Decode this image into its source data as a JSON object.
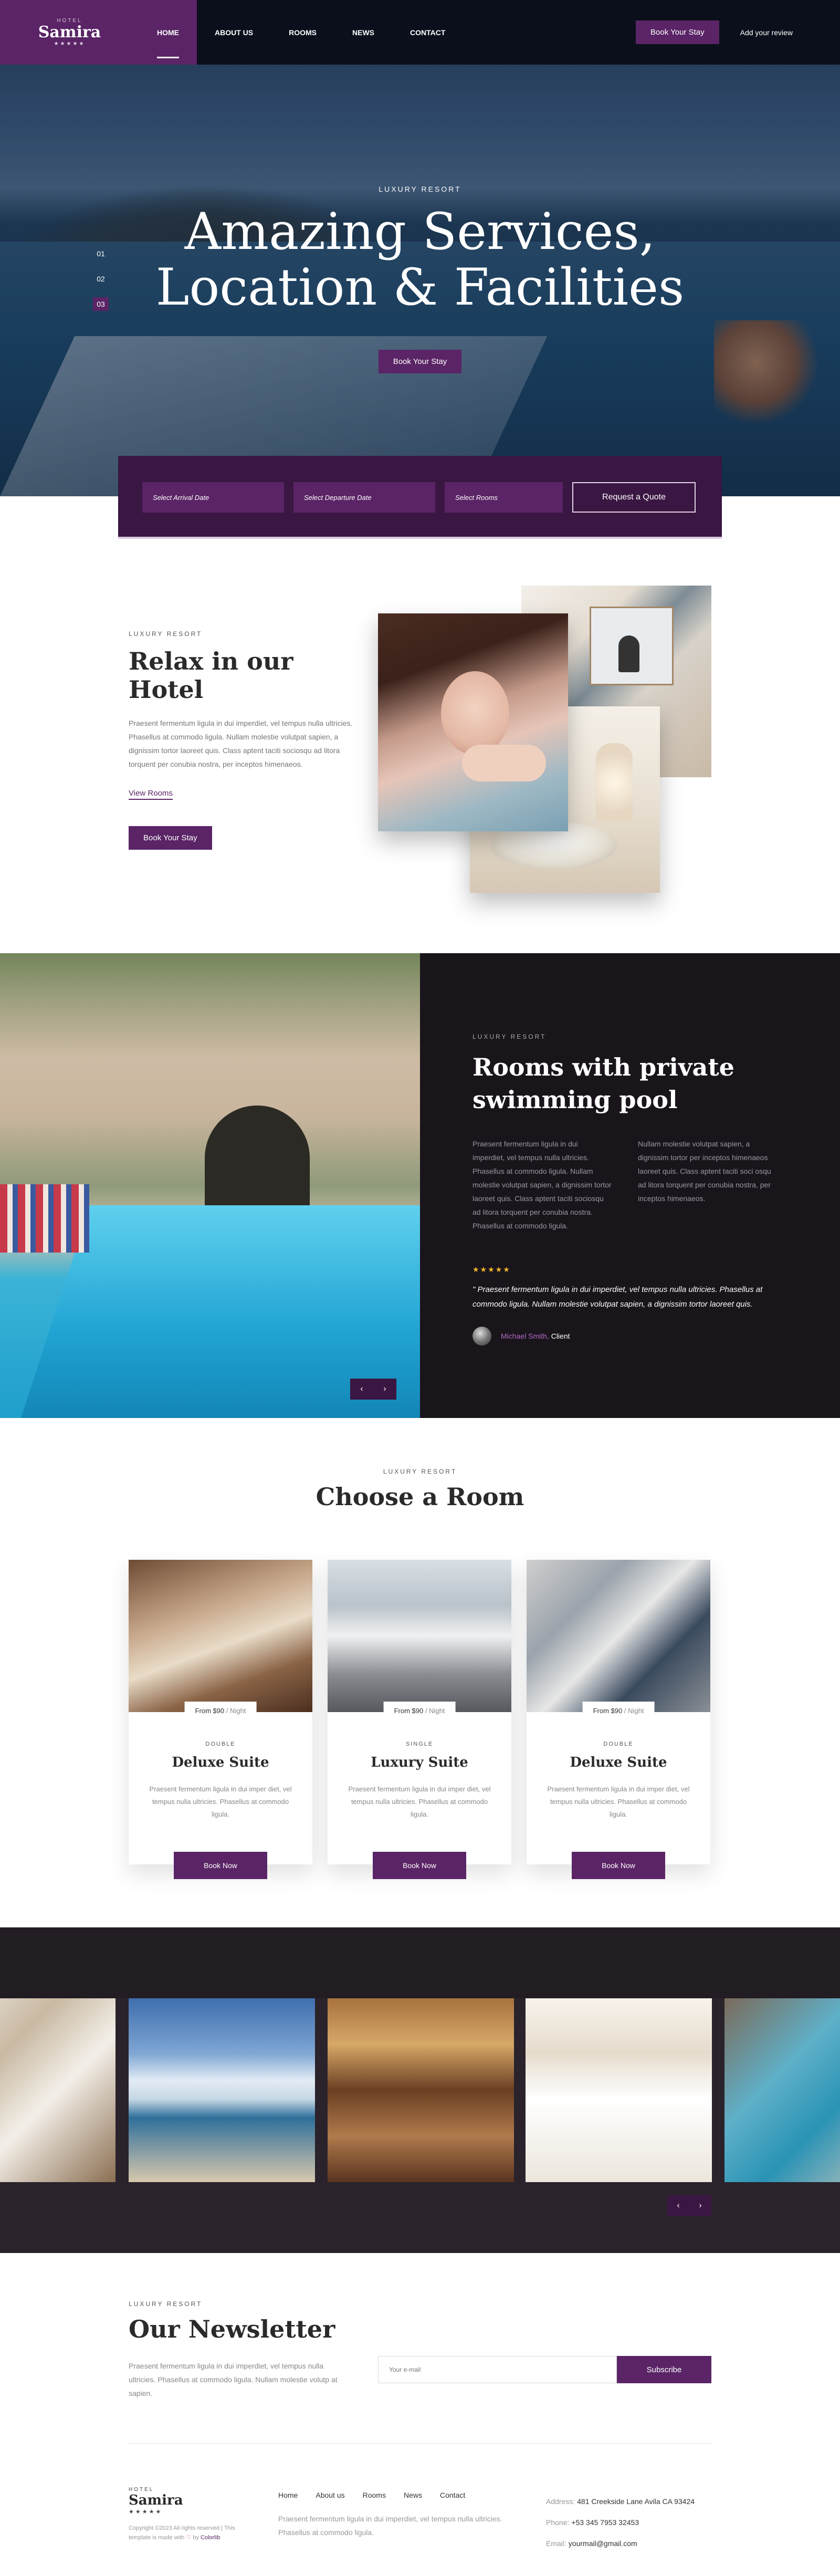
{
  "header": {
    "logo_small": "HOTEL",
    "logo_name": "Samira",
    "logo_stars": "★★★★★",
    "nav": [
      "HOME",
      "ABOUT US",
      "ROOMS",
      "NEWS",
      "CONTACT"
    ],
    "book_btn": "Book Your Stay",
    "add_review": "Add your review"
  },
  "hero": {
    "kicker": "LUXURY RESORT",
    "title_line1": "Amazing Services,",
    "title_line2": "Location & Facilities",
    "btn": "Book Your Stay",
    "slides": [
      "01",
      "02",
      "03"
    ],
    "active_slide": "03"
  },
  "booking": {
    "arrival": "Select Arrival Date",
    "departure": "Select Departure Date",
    "rooms": "Select Rooms",
    "quote_btn": "Request a Quote"
  },
  "relax": {
    "kicker": "LUXURY RESORT",
    "title": "Relax in our Hotel",
    "text": "Praesent fermentum ligula in dui imperdiet, vel tempus nulla ultricies. Phasellus at commodo ligula. Nullam molestie volutpat sapien, a dignissim tortor laoreet quis. Class aptent taciti sociosqu ad litora torquent per conubia nostra, per inceptos himenaeos.",
    "link": "View Rooms",
    "btn": "Book Your Stay"
  },
  "pool": {
    "kicker": "LUXURY RESORT",
    "title_line1": "Rooms with private",
    "title_line2": "swimming pool",
    "col1": "Praesent fermentum ligula in dui imperdiet, vel tempus nulla ultricies. Phasellus at commodo ligula. Nullam molestie volutpat sapien, a dignissim tortor laoreet quis. Class aptent taciti sociosqu ad litora torquent per conubia nostra. Phasellus at commodo ligula.",
    "col2": "Nullam molestie volutpat sapien, a dignissim tortor per inceptos himenaeos laoreet quis. Class aptent taciti soci osqu ad litora torquent per conubia nostra, per inceptos himenaeos.",
    "stars": "★★★★★",
    "quote": "\" Praesent fermentum ligula in dui imperdiet, vel tempus nulla ultricies. Phasellus at commodo ligula. Nullam molestie volutpat sapien, a dignissim tortor laoreet quis.",
    "client_name": "Michael Smith,",
    "client_role": "Client",
    "prev": "‹",
    "next": "›"
  },
  "rooms": {
    "kicker": "LUXURY RESORT",
    "title": "Choose a Room",
    "items": [
      {
        "price": "From $90",
        "per": " / Night",
        "type": "DOUBLE",
        "name": "Deluxe Suite",
        "desc": "Praesent fermentum ligula in dui imper diet, vel tempus nulla ultricies. Phasellus at commodo ligula.",
        "btn": "Book Now"
      },
      {
        "price": "From $90",
        "per": " / Night",
        "type": "SINGLE",
        "name": "Luxury Suite",
        "desc": "Praesent fermentum ligula in dui imper diet, vel tempus nulla ultricies. Phasellus at commodo ligula.",
        "btn": "Book Now"
      },
      {
        "price": "From $90",
        "per": " / Night",
        "type": "DOUBLE",
        "name": "Deluxe Suite",
        "desc": "Praesent fermentum ligula in dui imper diet, vel tempus nulla ultricies. Phasellus at commodo ligula.",
        "btn": "Book Now"
      }
    ]
  },
  "gallery": {
    "prev": "‹",
    "next": "›"
  },
  "newsletter": {
    "kicker": "LUXURY RESORT",
    "title": "Our Newsletter",
    "text": "Praesent fermentum ligula in dui imperdiet, vel tempus nulla ultricies. Phasellus at commodo ligula. Nullam molestie volutp at sapien.",
    "placeholder": "Your e-mail",
    "btn": "Subscribe"
  },
  "footer": {
    "logo_small": "HOTEL",
    "logo_name": "Samira",
    "logo_stars": "★★★★★",
    "copy_1": "Copyright ©2023 All rights reserved | This template is made with ",
    "heart": "♡",
    "copy_2": " by ",
    "colorlib": "Colorlib",
    "links": [
      "Home",
      "About us",
      "Rooms",
      "News",
      "Contact"
    ],
    "desc": "Praesent fermentum ligula in dui imperdiet, vel tempus nulla ultricies. Phasellus at commodo ligula.",
    "address_label": "Address:",
    "address": "481 Creekside Lane Avila CA 93424",
    "phone_label": "Phone:",
    "phone": "+53 345 7953 32453",
    "email_label": "Email:",
    "email": "yourmail@gmail.com"
  },
  "colors": {
    "brand_purple": "#5a2466",
    "dark_navy": "#0b0f1c",
    "dark_section": "#19151b"
  }
}
